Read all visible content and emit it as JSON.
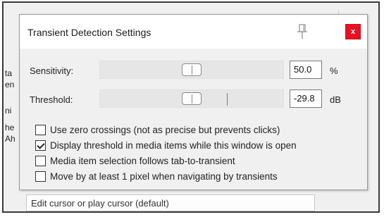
{
  "background": {
    "edge_texts": [
      "ta",
      "en",
      "ni",
      "he",
      "Ah"
    ],
    "bottom_field": "Edit cursor or play cursor (default)"
  },
  "dialog": {
    "title": "Transient Detection Settings",
    "close_label": "x",
    "sensitivity": {
      "label": "Sensitivity:",
      "value": "50.0",
      "unit": "%",
      "level_fraction": 0.5
    },
    "threshold": {
      "label": "Threshold:",
      "value": "-29.8",
      "unit": "dB",
      "level_fraction": 0.5
    },
    "options": [
      {
        "label": "Use zero crossings (not as precise but prevents clicks)",
        "checked": false
      },
      {
        "label": "Display threshold in media items while this window is open",
        "checked": true
      },
      {
        "label": "Media item selection follows tab-to-transient",
        "checked": false
      },
      {
        "label": "Move by at least 1 pixel when navigating by transients",
        "checked": false
      }
    ]
  },
  "icons": {
    "pin": "pin-icon",
    "close": "close-icon",
    "check": "checkmark-icon"
  },
  "colors": {
    "close_button": "#e81123",
    "dialog_bg": "#f0f0f0",
    "titlebar_bg": "#ffffff"
  }
}
